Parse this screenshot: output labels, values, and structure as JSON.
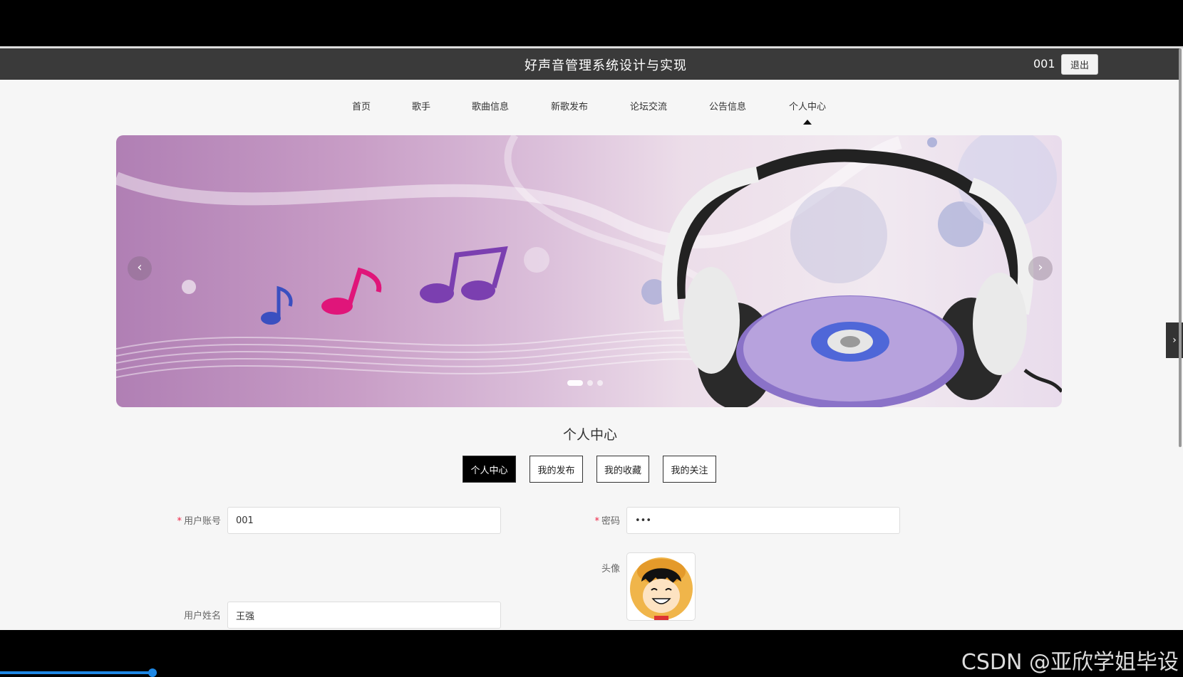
{
  "header": {
    "site_title": "好声音管理系统设计与实现",
    "username": "001",
    "logout_label": "退出"
  },
  "nav": {
    "items": [
      "首页",
      "歌手",
      "歌曲信息",
      "新歌发布",
      "论坛交流",
      "公告信息",
      "个人中心"
    ],
    "active": "个人中心"
  },
  "carousel": {
    "prev": "‹",
    "next": "›",
    "slide_count": 3,
    "active_index": 0
  },
  "profile": {
    "section_title": "个人中心",
    "tabs": [
      "个人中心",
      "我的发布",
      "我的收藏",
      "我的关注"
    ],
    "active_tab": "个人中心",
    "fields": {
      "account_label": "用户账号",
      "account_value": "001",
      "password_label": "密码",
      "password_value": "•••",
      "avatar_label": "头像",
      "name_label": "用户姓名",
      "name_value": "王强"
    }
  },
  "side_handle": "›",
  "watermark": "CSDN @亚欣学姐毕设",
  "colors": {
    "topbar": "#3a3a3a",
    "active_tab": "#000000",
    "required": "#ee2244",
    "progress": "#1e88e5"
  }
}
